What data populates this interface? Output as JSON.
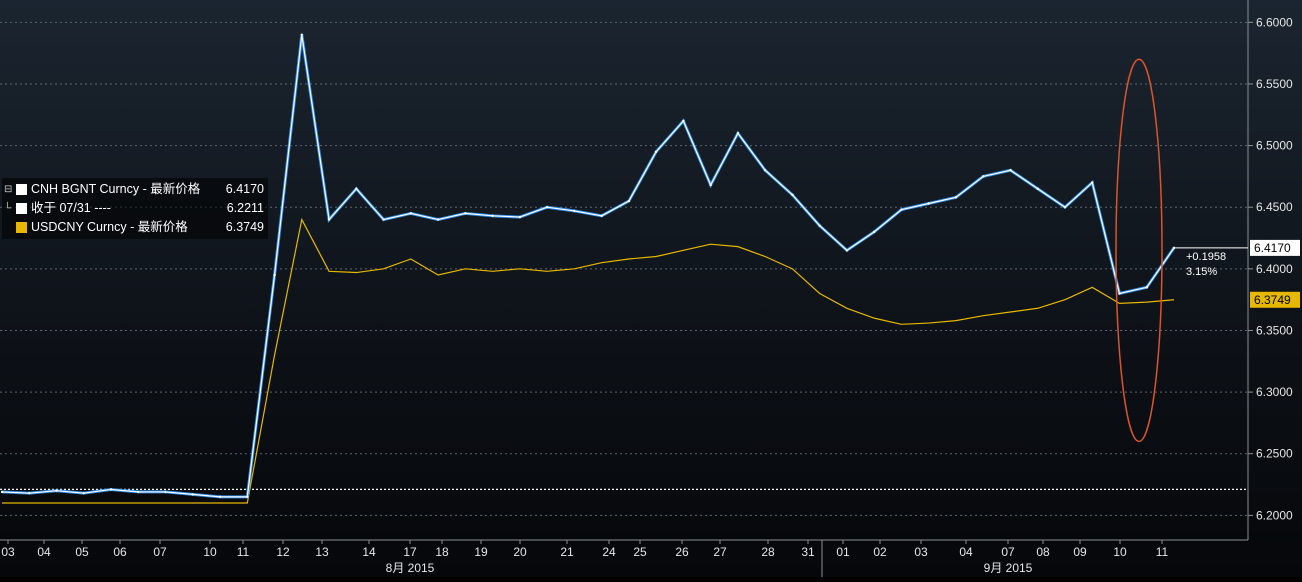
{
  "chart_data": {
    "type": "line",
    "ylim": [
      6.18,
      6.61
    ],
    "y_ticks": [
      "6.2000",
      "6.2500",
      "6.3000",
      "6.3500",
      "6.4000",
      "6.4500",
      "6.5000",
      "6.5500",
      "6.6000"
    ],
    "x_tick_labels": [
      "03",
      "04",
      "05",
      "06",
      "07",
      "10",
      "11",
      "12",
      "13",
      "14",
      "17",
      "18",
      "19",
      "20",
      "21",
      "24",
      "25",
      "26",
      "27",
      "28",
      "31",
      "01",
      "02",
      "03",
      "04",
      "07",
      "08",
      "09",
      "10",
      "11"
    ],
    "month_labels": [
      "8月 2015",
      "9月 2015"
    ],
    "legend": [
      {
        "name": "CNH BGNT Curncy - 最新价格",
        "value": "6.4170",
        "color": "#ffffff"
      },
      {
        "name": "收于 07/31 ----",
        "value": "6.2211",
        "color": "#ffffff"
      },
      {
        "name": "USDCNY Curncy - 最新价格",
        "value": "6.3749",
        "color": "#e6b800"
      }
    ],
    "reference_line": {
      "value": 6.2211,
      "style": "dotted"
    },
    "series": [
      {
        "name": "CNH BGNT Curncy",
        "color": "#ffffff",
        "accent": "#2f8be8",
        "values": [
          6.219,
          6.218,
          6.22,
          6.218,
          6.221,
          6.219,
          6.219,
          6.217,
          6.215,
          6.215,
          6.395,
          6.59,
          6.44,
          6.465,
          6.44,
          6.445,
          6.44,
          6.445,
          6.443,
          6.442,
          6.45,
          6.447,
          6.443,
          6.455,
          6.495,
          6.52,
          6.468,
          6.51,
          6.48,
          6.46,
          6.435,
          6.415,
          6.43,
          6.448,
          6.453,
          6.458,
          6.475,
          6.48,
          6.465,
          6.45,
          6.47,
          6.38,
          6.385,
          6.417
        ]
      },
      {
        "name": "USDCNY Curncy",
        "color": "#e6b800",
        "values": [
          6.21,
          6.21,
          6.21,
          6.21,
          6.21,
          6.21,
          6.21,
          6.21,
          6.21,
          6.21,
          6.33,
          6.44,
          6.398,
          6.397,
          6.4,
          6.408,
          6.395,
          6.4,
          6.398,
          6.4,
          6.398,
          6.4,
          6.405,
          6.408,
          6.41,
          6.415,
          6.42,
          6.418,
          6.41,
          6.4,
          6.38,
          6.368,
          6.36,
          6.355,
          6.356,
          6.358,
          6.362,
          6.365,
          6.368,
          6.375,
          6.385,
          6.372,
          6.373,
          6.3749
        ]
      }
    ],
    "annotations": {
      "change_abs": "+0.1958",
      "change_pct": "3.15%",
      "last_cnh": "6.4170",
      "last_usdcny": "6.3749"
    },
    "highlight_ellipse": {
      "x_range": [
        "10",
        "11"
      ],
      "y_range": [
        6.26,
        6.57
      ],
      "color": "#d9552a"
    }
  }
}
